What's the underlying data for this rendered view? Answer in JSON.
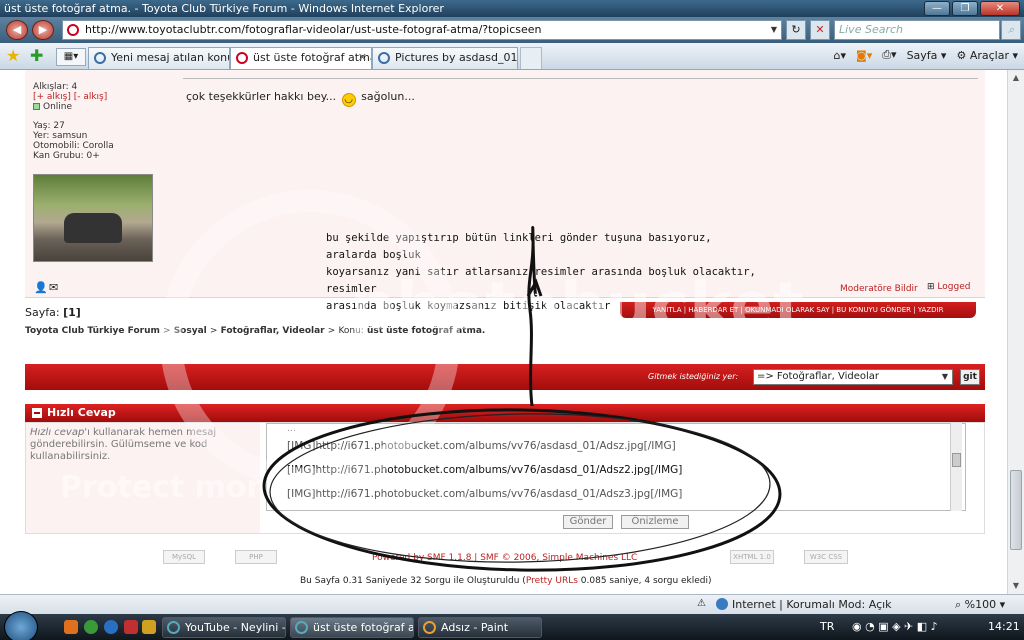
{
  "window": {
    "title": "üst üste fotoğraf atma. - Toyota Club Türkiye Forum - Windows Internet Explorer",
    "controls": {
      "minimize": "—",
      "maximize": "❐",
      "close": "✕"
    }
  },
  "address": {
    "url": "http://www.toyotaclubtr.com/fotograflar-videolar/ust-uste-fotograf-atma/?topicseen",
    "search_placeholder": "Live Search"
  },
  "tabs": [
    {
      "label": "Yeni mesaj atılan konular",
      "active": false
    },
    {
      "label": "üst üste fotoğraf atma. ...",
      "active": true
    },
    {
      "label": "Pictures by asdasd_01 - Ph...",
      "active": false
    }
  ],
  "commandbar": {
    "page": "Sayfa",
    "tools": "Araçlar"
  },
  "profile": {
    "claps": "Alkışlar: 4",
    "clap_links": "[+ alkış] [- alkış]",
    "status": "Online",
    "age": "Yaş: 27",
    "location": "Yer: samsun",
    "car": "Otomobili: Corolla",
    "blood": "Kan Grubu: 0+"
  },
  "post": {
    "message_before": "çok teşekkürler hakkı bey...",
    "message_after": "sağolun...",
    "annotation_lines": [
      "bu şekilde yapıştırıp bütün linkleri gönder tuşuna basıyoruz, aralarda boşluk",
      "koyarsanız yani satır atlarsanız resimler arasında boşluk olacaktır, resimler",
      "arasında boşluk koymazsanız bitişik olacaktır"
    ],
    "report_link": "Moderatöre Bildir",
    "logged": "Logged"
  },
  "pagination": {
    "label": "Sayfa:",
    "current": "[1]"
  },
  "actions": "YANITLA  |  HABERDAR ET  |  OKUNMADI OLARAK SAY  |  BU KONUYU GÖNDER  |  YAZDIR",
  "breadcrumb": {
    "forum": "Toyota Club Türkiye Forum",
    "sep1": ">",
    "social": "Sosyal",
    "sep2": ">",
    "section": "Fotoğraflar, Videolar",
    "sep3": ">",
    "topic_prefix": "Konu:",
    "topic": "üst üste fotoğraf atma."
  },
  "jump": {
    "label": "Gitmek istediğiniz yer:",
    "value": "=> Fotoğraflar, Videolar",
    "button": "git"
  },
  "quick_reply": {
    "title": "Hızlı Cevap",
    "help_em": "Hızlı cevap",
    "help_rest": "'ı kullanarak hemen mesaj gönderebilirsin. Gülümseme ve kod kullanabilirsiniz.",
    "textarea_lines": [
      "[IMG]http://i671.photobucket.com/albums/vv76/asdasd_01/Adsz.jpg[/IMG]",
      "[IMG]http://i671.photobucket.com/albums/vv76/asdasd_01/Adsz2.jpg[/IMG]",
      "[IMG]http://i671.photobucket.com/albums/vv76/asdasd_01/Adsz3.jpg[/IMG]"
    ],
    "send": "Gönder",
    "preview": "Önizleme"
  },
  "footer": {
    "powered": "Powered by SMF 1.1.8 | SMF © 2006, Simple Machines LLC",
    "gen_prefix": "Bu Sayfa 0.31 Saniyede 32 Sorgu ile Oluşturuldu (",
    "gen_link": "Pretty URLs",
    "gen_suffix": " 0.085 saniye, 4 sorgu ekledi)",
    "logos": [
      "MySQL",
      "PHP",
      "XHTML 1.0",
      "W3C CSS"
    ]
  },
  "watermark": {
    "brand": "photobucket",
    "protect": "Protect more"
  },
  "statusbar": {
    "zone": "Internet | Korumalı Mod: Açık",
    "zoom": "%100"
  },
  "taskbar": {
    "items": [
      {
        "label": "YouTube - Neylini - ...",
        "active": false
      },
      {
        "label": "üst üste fotoğraf at...",
        "active": true
      },
      {
        "label": "Adsız - Paint",
        "active": false
      }
    ],
    "lang": "TR",
    "time": "14:21"
  }
}
